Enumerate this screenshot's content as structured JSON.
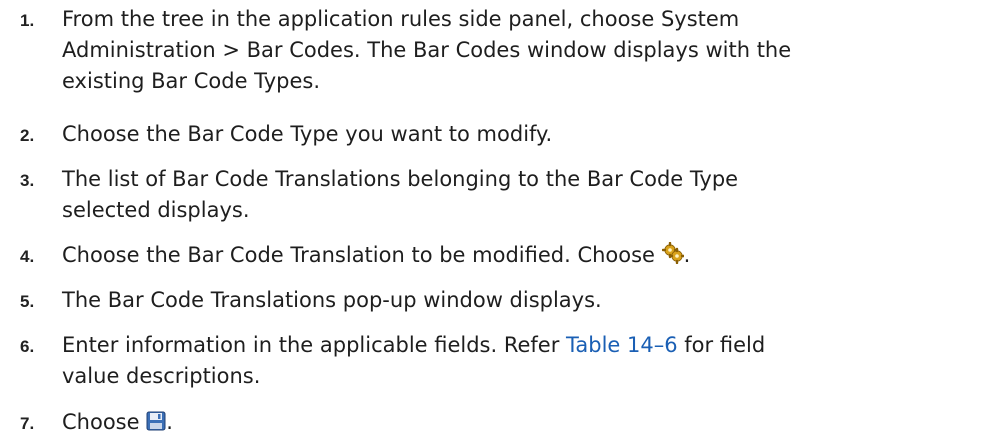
{
  "steps": [
    {
      "number": "1.",
      "text": "From the tree in the application rules side panel, choose System\nAdministration > Bar Codes. The Bar Codes window displays with the\nexisting Bar Code Types."
    },
    {
      "number": "2.",
      "text": "Choose the Bar Code Type you want to modify."
    },
    {
      "number": "3.",
      "text": "The list of Bar Code Translations belonging to the Bar Code Type\nselected displays."
    },
    {
      "number": "4.",
      "text_before": "Choose the Bar Code Translation to be modified. Choose ",
      "icon": "gear-icon",
      "text_after": "."
    },
    {
      "number": "5.",
      "text": "The Bar Code Translations pop-up window displays."
    },
    {
      "number": "6.",
      "text_before": "Enter information in the applicable fields. Refer ",
      "link": "Table 14–6",
      "text_after": " for field\nvalue descriptions."
    },
    {
      "number": "7.",
      "text_before": "Choose ",
      "icon": "save-icon",
      "text_after": "."
    }
  ],
  "colors": {
    "link": "#1a5fb4",
    "gear": "#d9a21b",
    "save": "#3b6fb6"
  }
}
